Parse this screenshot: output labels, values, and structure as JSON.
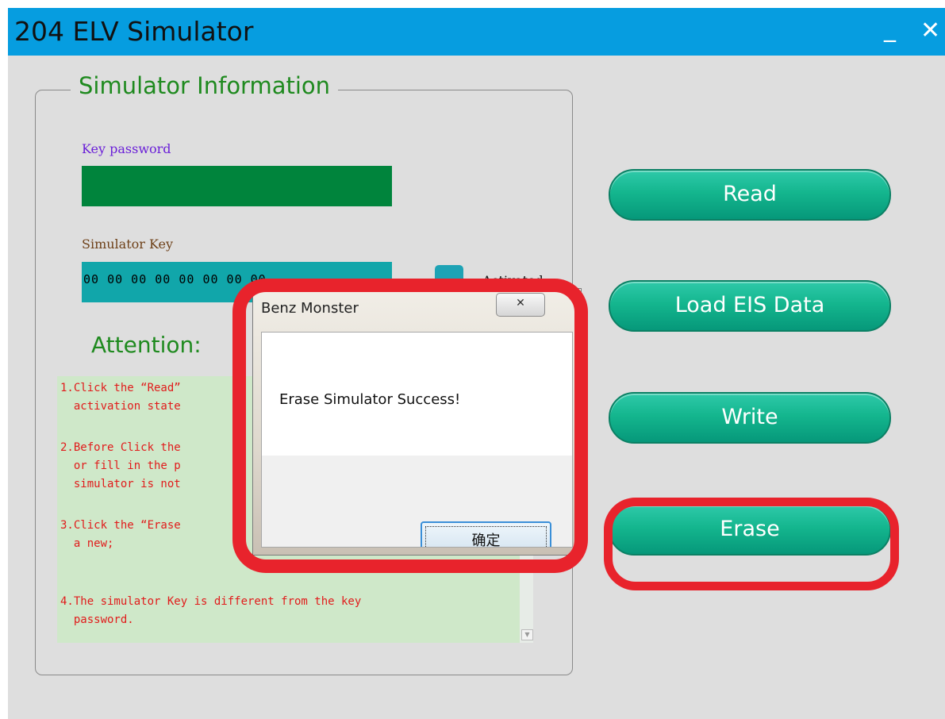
{
  "window": {
    "title": "204 ELV Simulator",
    "minimize_glyph": "_",
    "close_glyph": "✕"
  },
  "simulator_info": {
    "legend": "Simulator Information",
    "key_password_label": "Key password",
    "key_password_value": "",
    "simulator_key_label": "Simulator Key",
    "simulator_key_value": "00 00 00 00 00 00 00 00",
    "activated_label": "Activated"
  },
  "attention": {
    "heading": "Attention:",
    "notes": [
      "1.Click the “Read”\n  activation state",
      "2.Before Click the\n  or fill in the p\n  simulator is not",
      "3.Click the “Erase\n  a new;",
      "4.The simulator Key is different from the key\n  password."
    ]
  },
  "buttons": {
    "read": "Read",
    "load_eis": "Load EIS Data",
    "write": "Write",
    "erase": "Erase"
  },
  "dialog": {
    "title": "Benz Monster",
    "message": "Erase Simulator Success!",
    "ok_label": "确定",
    "close_glyph": "✕"
  },
  "colors": {
    "titlebar": "#069de0",
    "key_password_field": "#00843c",
    "simulator_key_field": "#11a6aa",
    "notes_bg": "#cfe8c9",
    "notes_text": "#e11b1b",
    "button_green": "#14b68e",
    "annotation_red": "#e8232c"
  }
}
